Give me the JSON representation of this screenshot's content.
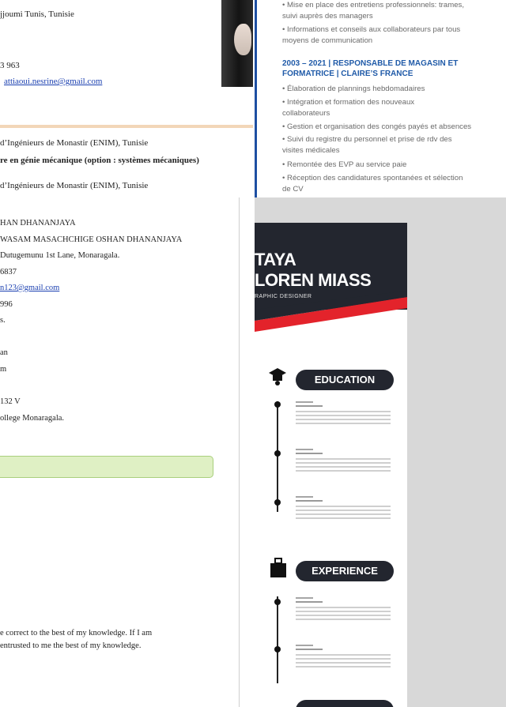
{
  "cv_top_left": {
    "address": "jjoumi Tunis, Tunisie",
    "phone": "3 963",
    "email": "attiaoui.nesrine@gmail.com",
    "edu_school_1": "d’Ingénieurs de Monastir (ENIM), Tunisie",
    "edu_degree": "re en génie mécanique (option : systèmes mécaniques)",
    "edu_school_2": "d’Ingénieurs de Monastir (ENIM), Tunisie"
  },
  "cv_top_right": {
    "bullets_top": [
      "•  Mise en place des entretiens professionnels: trames,",
      "suivi auprès des managers",
      "•  Informations et conseils aux collaborateurs par tous",
      "moyens de communication"
    ],
    "job_heading_1": "2003  –  2021  |  RESPONSABLE  DE  MAGASIN  ET",
    "job_heading_2": "FORMATRICE | CLAIRE’S FRANCE",
    "bullets_job": [
      "•  Élaboration de plannings hebdomadaires",
      "•  Intégration      et      formation      des      nouveaux",
      "collaborateurs",
      "•  Gestion et organisation des congés payés et absences",
      "•  Suivi  du  registre  du  personnel  et  prise  de  rdv  des",
      "visites médicales",
      "•  Remontée des EVP au service paie",
      "•  Réception  des  candidatures  spontanées  et  sélection",
      "de CV"
    ]
  },
  "cv_bottom_left": {
    "lines": [
      "HAN DHANANJAYA",
      "WASAM MASACHCHIGE OSHAN DHANANJAYA",
      "Dutugemunu 1st Lane, Monaragala.",
      "6837",
      "n123@gmail.com",
      "996",
      "s.",
      "an",
      "m",
      "132 V",
      "ollege Monaragala."
    ],
    "declaration_1": "e correct to the best of my knowledge. If I am",
    "declaration_2": "entrusted to me the best of  my knowledge."
  },
  "cv_bottom_right": {
    "name_line_1": "TAYA",
    "name_line_2": "LOREN MIASS",
    "role": "RAPHIC DESIGNER",
    "section_education": "EDUCATION",
    "section_experience": "EXPERIENCE",
    "accent_color": "#e3232b",
    "dark_color": "#23262f"
  }
}
